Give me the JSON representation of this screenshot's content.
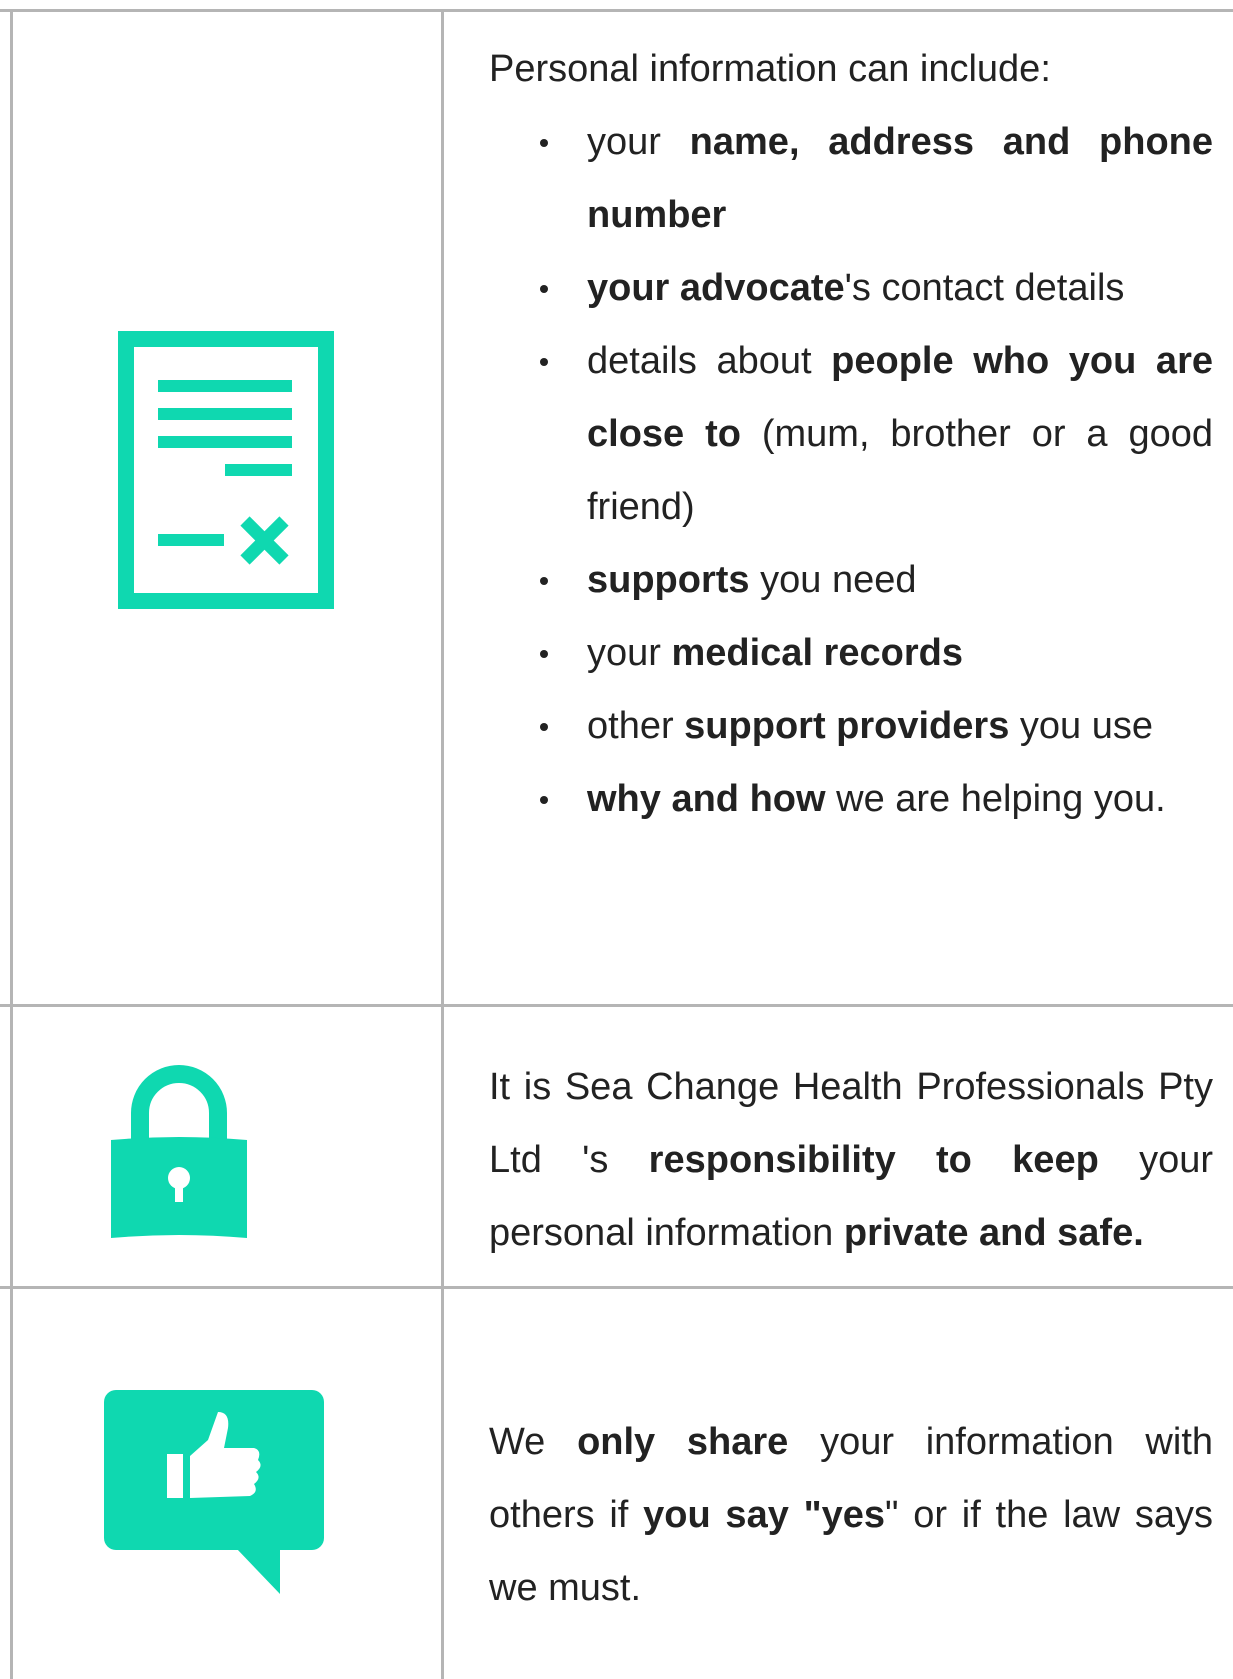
{
  "colors": {
    "accent": "#0fd8b0",
    "border": "#b5b5b5",
    "text": "#222222"
  },
  "rows": [
    {
      "icon": "document-cross-icon",
      "intro": "Personal information can include:",
      "items": [
        {
          "parts": [
            {
              "t": "your ",
              "b": false
            },
            {
              "t": "name, address and phone number",
              "b": true
            }
          ]
        },
        {
          "parts": [
            {
              "t": "your advocate",
              "b": true
            },
            {
              "t": "'s contact details",
              "b": false
            }
          ]
        },
        {
          "parts": [
            {
              "t": "details about ",
              "b": false
            },
            {
              "t": "people who you are close to",
              "b": true
            },
            {
              "t": " (mum, brother or a good friend)",
              "b": false
            }
          ]
        },
        {
          "parts": [
            {
              "t": "supports",
              "b": true
            },
            {
              "t": " you need",
              "b": false
            }
          ]
        },
        {
          "parts": [
            {
              "t": "your ",
              "b": false
            },
            {
              "t": "medical records",
              "b": true
            }
          ]
        },
        {
          "parts": [
            {
              "t": "other ",
              "b": false
            },
            {
              "t": "support providers",
              "b": true
            },
            {
              "t": " you use",
              "b": false
            }
          ]
        },
        {
          "parts": [
            {
              "t": "why and how",
              "b": true
            },
            {
              "t": " we are helping you.",
              "b": false
            }
          ]
        }
      ]
    },
    {
      "icon": "padlock-icon",
      "parts": [
        {
          "t": "It is Sea Change Health Professionals Pty Ltd 's ",
          "b": false
        },
        {
          "t": "responsibility to keep",
          "b": true
        },
        {
          "t": " your personal information ",
          "b": false
        },
        {
          "t": "private and safe.",
          "b": true
        }
      ]
    },
    {
      "icon": "thumbs-up-speech-bubble-icon",
      "parts": [
        {
          "t": "We ",
          "b": false
        },
        {
          "t": "only share",
          "b": true
        },
        {
          "t": " your information with others if ",
          "b": false
        },
        {
          "t": "you say \"yes",
          "b": true
        },
        {
          "t": "\" or if the law says we must.",
          "b": false
        }
      ]
    }
  ]
}
